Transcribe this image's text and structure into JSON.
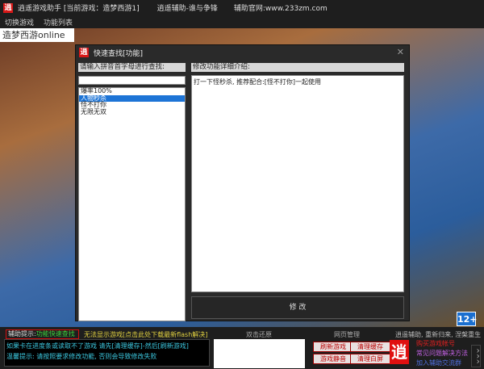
{
  "titlebar": {
    "logo": "逍",
    "title": "逍遥游戏助手 [当前游戏：造梦西游1]",
    "version": "逍遥辅助-谁与争锋",
    "site": "辅助官网:www.233zm.com"
  },
  "menu": [
    "切换游戏",
    "功能列表"
  ],
  "game": {
    "title": "造梦西游online",
    "age_badge": "12+"
  },
  "dialog": {
    "logo": "逍",
    "title": "快速查找[功能]",
    "close": "✕",
    "search_label": "请输入拼音首字母进行查找:",
    "search_value": "",
    "list": [
      "爆率100%",
      "人物秒杀",
      "怪不打你",
      "无限无双"
    ],
    "selected_index": 1,
    "detail_label": "修改功能详细介绍:",
    "detail_text": "打一下怪秒杀, 推荐配合:[怪不打你]一起使用",
    "modify_button": "修 改"
  },
  "bottom": {
    "hint_label": "辅助提示:",
    "hint_link": "功能快速查找",
    "flash_notice": "无法显示游戏[点击此处下载最新flash解决]",
    "log": [
      "如果卡在进度条或读取不了游戏 请先[清理缓存]-然后[刷新游戏]",
      "温馨提示: 请按照要求修改功能, 否则会导致修改失败"
    ],
    "restore_label": "双击还原",
    "web_label": "网页管理",
    "buttons": [
      "刷新游戏",
      "清理缓存",
      "游戏静音",
      "清理白屏"
    ],
    "slogan": "逍遥辅助, 重新归来, 涅槃重生",
    "logo": "逍",
    "links": [
      "购买游戏帐号",
      "常见问题解决方法",
      "加入辅助交流群"
    ],
    "collapse": "^^^"
  }
}
